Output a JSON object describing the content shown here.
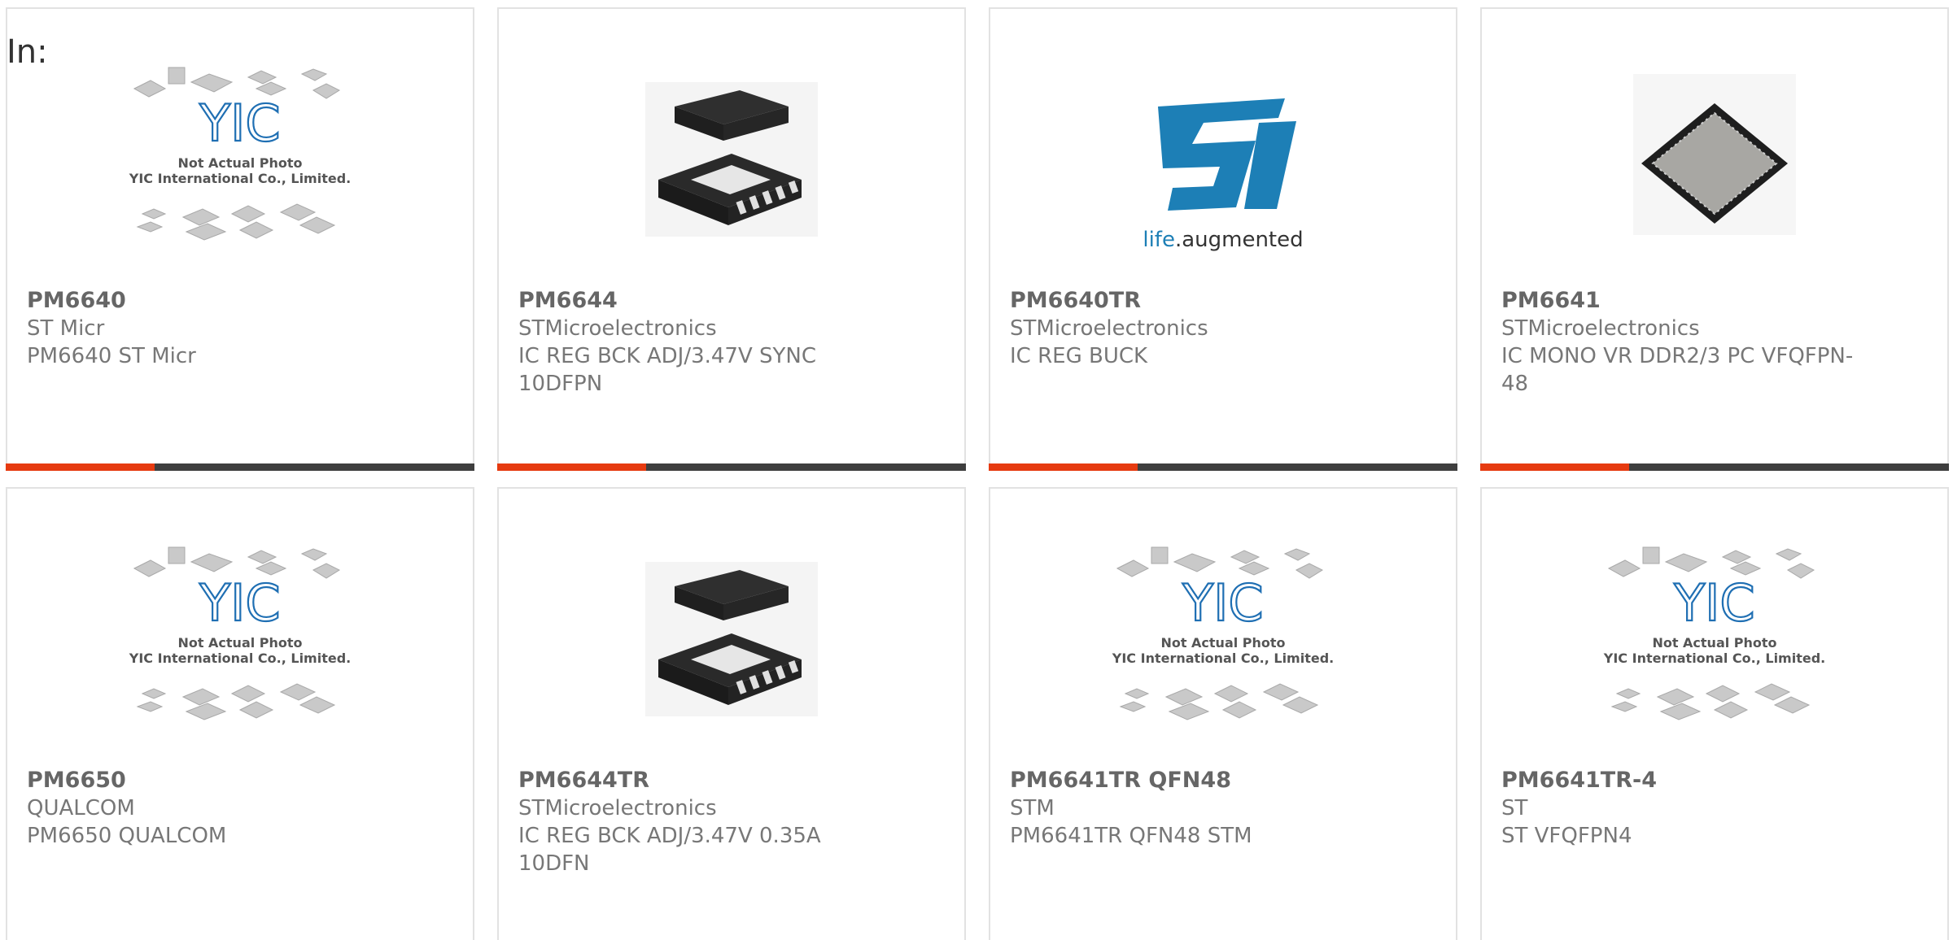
{
  "page": {
    "in_label": "In:"
  },
  "placeholder_text": {
    "line1": "Not Actual Photo",
    "line2": "YIC International Co., Limited.",
    "logo": "YIC"
  },
  "st_logo_text": {
    "prefix": "life",
    "suffix": ".augmented"
  },
  "products": [
    {
      "part": "PM6640",
      "manufacturer": "ST Micr",
      "description": "PM6640 ST Micr",
      "image": "placeholder-photo"
    },
    {
      "part": "PM6644",
      "manufacturer": "STMicroelectronics",
      "description": "IC REG BCK ADJ/3.47V SYNC 10DFPN",
      "image": "dfn-chip"
    },
    {
      "part": "PM6640TR",
      "manufacturer": "STMicroelectronics",
      "description": "IC REG BUCK",
      "image": "st-logo"
    },
    {
      "part": "PM6641",
      "manufacturer": "STMicroelectronics",
      "description": "IC MONO VR DDR2/3 PC VFQFPN-48",
      "image": "qfn-chip"
    },
    {
      "part": "PM6650",
      "manufacturer": "QUALCOM",
      "description": "PM6650 QUALCOM",
      "image": "placeholder-photo"
    },
    {
      "part": "PM6644TR",
      "manufacturer": "STMicroelectronics",
      "description": "IC REG BCK ADJ/3.47V 0.35A 10DFN",
      "image": "dfn-chip"
    },
    {
      "part": "PM6641TR QFN48",
      "manufacturer": "STM",
      "description": "PM6641TR QFN48 STM",
      "image": "placeholder-photo"
    },
    {
      "part": "PM6641TR-4",
      "manufacturer": "ST",
      "description": "ST VFQFPN4",
      "image": "placeholder-photo"
    }
  ],
  "colors": {
    "accent_bar": "#e63a10",
    "dark_bar": "#3e3e3e",
    "st_blue": "#1d7fb6",
    "yic_blue": "#1f6fb3"
  }
}
